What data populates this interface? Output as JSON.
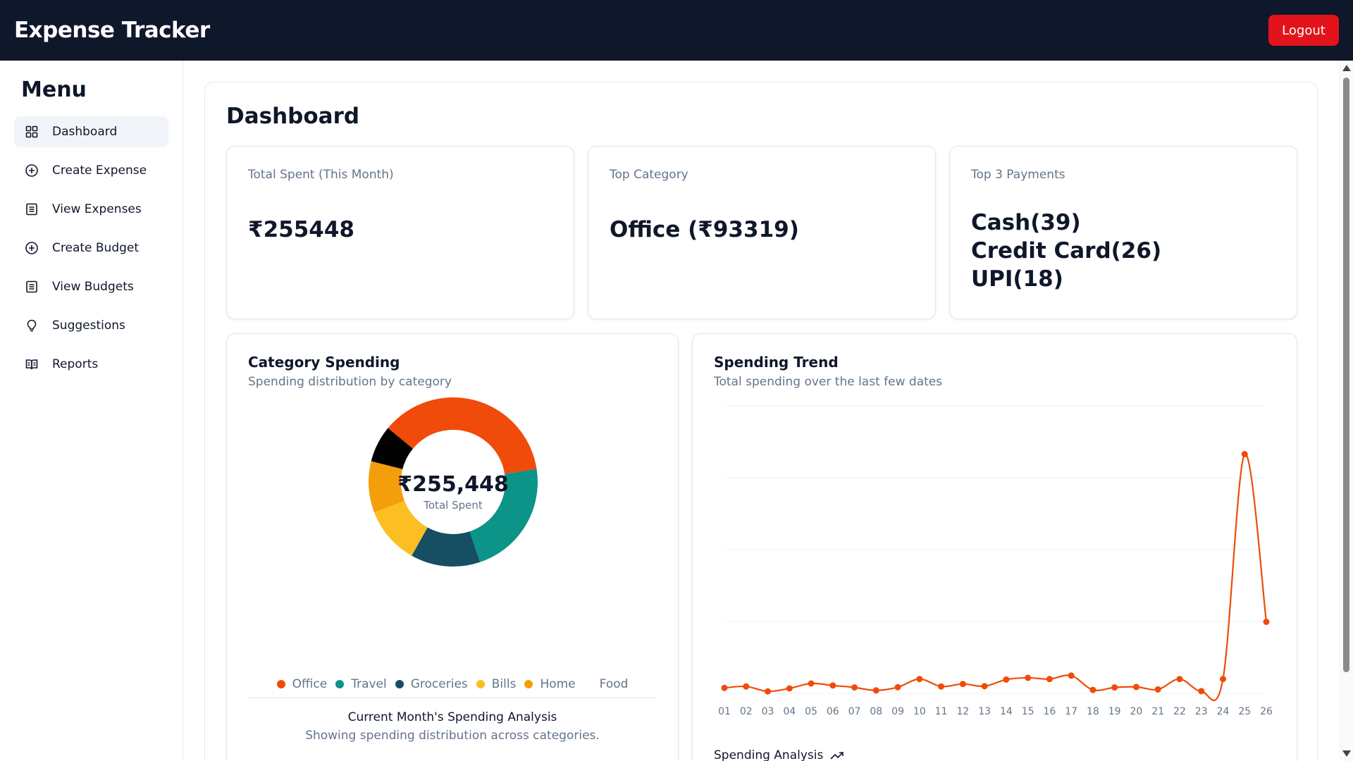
{
  "header": {
    "title": "Expense Tracker",
    "logout_label": "Logout"
  },
  "sidebar": {
    "title": "Menu",
    "items": [
      {
        "label": "Dashboard",
        "icon": "grid-icon",
        "active": true
      },
      {
        "label": "Create Expense",
        "icon": "plus-circle-icon"
      },
      {
        "label": "View Expenses",
        "icon": "list-icon"
      },
      {
        "label": "Create Budget",
        "icon": "plus-circle-icon"
      },
      {
        "label": "View Budgets",
        "icon": "list-icon"
      },
      {
        "label": "Suggestions",
        "icon": "lightbulb-icon"
      },
      {
        "label": "Reports",
        "icon": "book-icon"
      }
    ]
  },
  "dashboard": {
    "title": "Dashboard",
    "stats": {
      "total_label": "Total Spent (This Month)",
      "total_value": "₹255448",
      "top_category_label": "Top Category",
      "top_category_value": "Office (₹93319)",
      "top_payments_label": "Top 3 Payments",
      "payments": [
        "Cash(39)",
        "Credit Card(26)",
        "UPI(18)"
      ]
    },
    "category_card": {
      "title": "Category Spending",
      "subtitle": "Spending distribution by category",
      "center_value": "₹255,448",
      "center_label": "Total Spent",
      "legend": [
        {
          "label": "Office",
          "color": "#f04b0a"
        },
        {
          "label": "Travel",
          "color": "#0d9488"
        },
        {
          "label": "Groceries",
          "color": "#164e63"
        },
        {
          "label": "Bills",
          "color": "#fbbf24"
        },
        {
          "label": "Home",
          "color": "#f59e0b"
        },
        {
          "label": "Food",
          "color": "#000000"
        }
      ],
      "footer_title": "Current Month's Spending Analysis",
      "footer_sub": "Showing spending distribution across categories."
    },
    "trend_card": {
      "title": "Spending Trend",
      "subtitle": "Total spending over the last few dates",
      "footer": "Spending Analysis"
    }
  },
  "chart_data": [
    {
      "type": "pie",
      "title": "Category Spending",
      "categories": [
        "Office",
        "Travel",
        "Groceries",
        "Bills",
        "Home",
        "Food"
      ],
      "values": [
        93319,
        57000,
        34000,
        28000,
        25129,
        18000
      ],
      "colors": [
        "#f04b0a",
        "#0d9488",
        "#164e63",
        "#fbbf24",
        "#f59e0b",
        "#000000"
      ],
      "legend": "bottom"
    },
    {
      "type": "line",
      "title": "Spending Trend",
      "categories": [
        "01",
        "02",
        "03",
        "04",
        "05",
        "06",
        "07",
        "08",
        "09",
        "10",
        "11",
        "12",
        "13",
        "14",
        "15",
        "16",
        "17",
        "18",
        "19",
        "20",
        "21",
        "22",
        "23",
        "24",
        "25",
        "26"
      ],
      "values": [
        2200,
        2800,
        800,
        2000,
        4000,
        3200,
        2400,
        1200,
        2500,
        5800,
        2800,
        3800,
        2900,
        5600,
        6300,
        5800,
        7200,
        1400,
        2400,
        2600,
        1600,
        5800,
        900,
        5800,
        97000,
        29000
      ],
      "line_color": "#f04b0a",
      "ylim": [
        0,
        120000
      ],
      "grid": true
    }
  ]
}
